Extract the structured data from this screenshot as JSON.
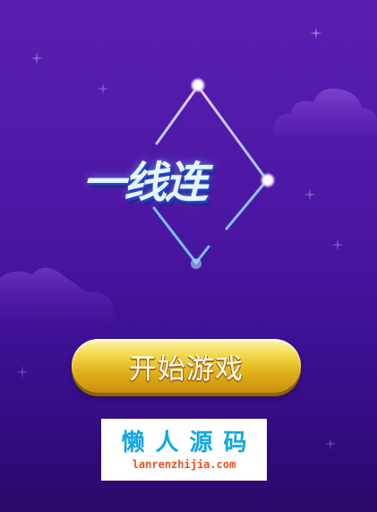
{
  "game": {
    "title": "一线连",
    "start_button_label": "开始游戏"
  },
  "watermark": {
    "name": "懒人源码",
    "url": "lanrenzhijia.com"
  },
  "colors": {
    "background_top": "#5a1fb2",
    "background_bottom": "#2a0869",
    "button_gold": "#e0b21a",
    "watermark_blue": "#12a7e8",
    "watermark_orange": "#e8541a"
  },
  "icons": [
    "diamond-line-logo",
    "node-dot",
    "cloud",
    "sparkle-star"
  ]
}
